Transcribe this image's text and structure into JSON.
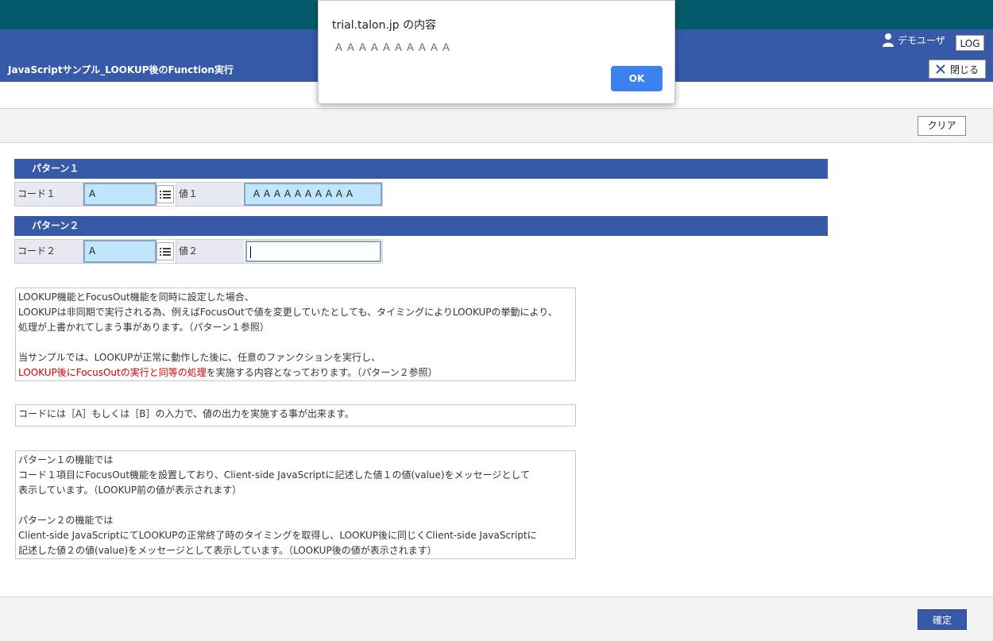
{
  "header": {
    "app_title": "JavaScriptサンプル_LOOKUP後のFunction実行",
    "user_name": "デモユーザ",
    "log_label": "LOG",
    "close_label": "閉じる",
    "header_color": "#3659a8",
    "topbar_color": "#045a6a"
  },
  "toolbar": {
    "clear_label": "クリア"
  },
  "pattern1": {
    "title": "パターン１",
    "code_label": "コード１",
    "code_value": "A",
    "value_label": "値１",
    "value_value": "ＡＡＡＡＡＡＡＡＡＡ"
  },
  "pattern2": {
    "title": "パターン２",
    "code_label": "コード２",
    "code_value": "A",
    "value_label": "値２",
    "value_value": ""
  },
  "notes": {
    "note1": {
      "line1": "LOOKUP機能とFocusOut機能を同時に設定した場合、",
      "line2": "LOOKUPは非同期で実行される為、例えばFocusOutで値を変更していたとしても、タイミングによりLOOKUPの挙動により、",
      "line3": "処理が上書かれてしまう事があります。（パターン１参照）",
      "line4": "当サンプルでは、LOOKUPが正常に動作した後に、任意のファンクションを実行し、",
      "line5_red": "LOOKUP後にFocusOutの実行と同等の処理",
      "line5_rest": "を実施する内容となっております。（パターン２参照）"
    },
    "note2": {
      "line1": "コードには［A］もしくは［B］の入力で、値の出力を実施する事が出来ます。"
    },
    "note3": {
      "line1": "パターン１の機能では",
      "line2": "コード１項目にFocusOut機能を設置しており、Client-side JavaScriptに記述した値１の値(value)をメッセージとして",
      "line3": "表示しています。（LOOKUP前の値が表示されます）",
      "line4": "パターン２の機能では",
      "line5": "Client-side JavaScriptにてLOOKUPの正常終了時のタイミングを取得し、LOOKUP後に同じくClient-side JavaScriptに",
      "line6": "記述した値２の値(value)をメッセージとして表示しています。（LOOKUP後の値が表示されます）"
    }
  },
  "footer": {
    "confirm_label": "確定"
  },
  "dialog": {
    "title": "trial.talon.jp の内容",
    "message": "ＡＡＡＡＡＡＡＡＡＡ",
    "ok_label": "OK",
    "ok_color": "#3b82f0"
  }
}
